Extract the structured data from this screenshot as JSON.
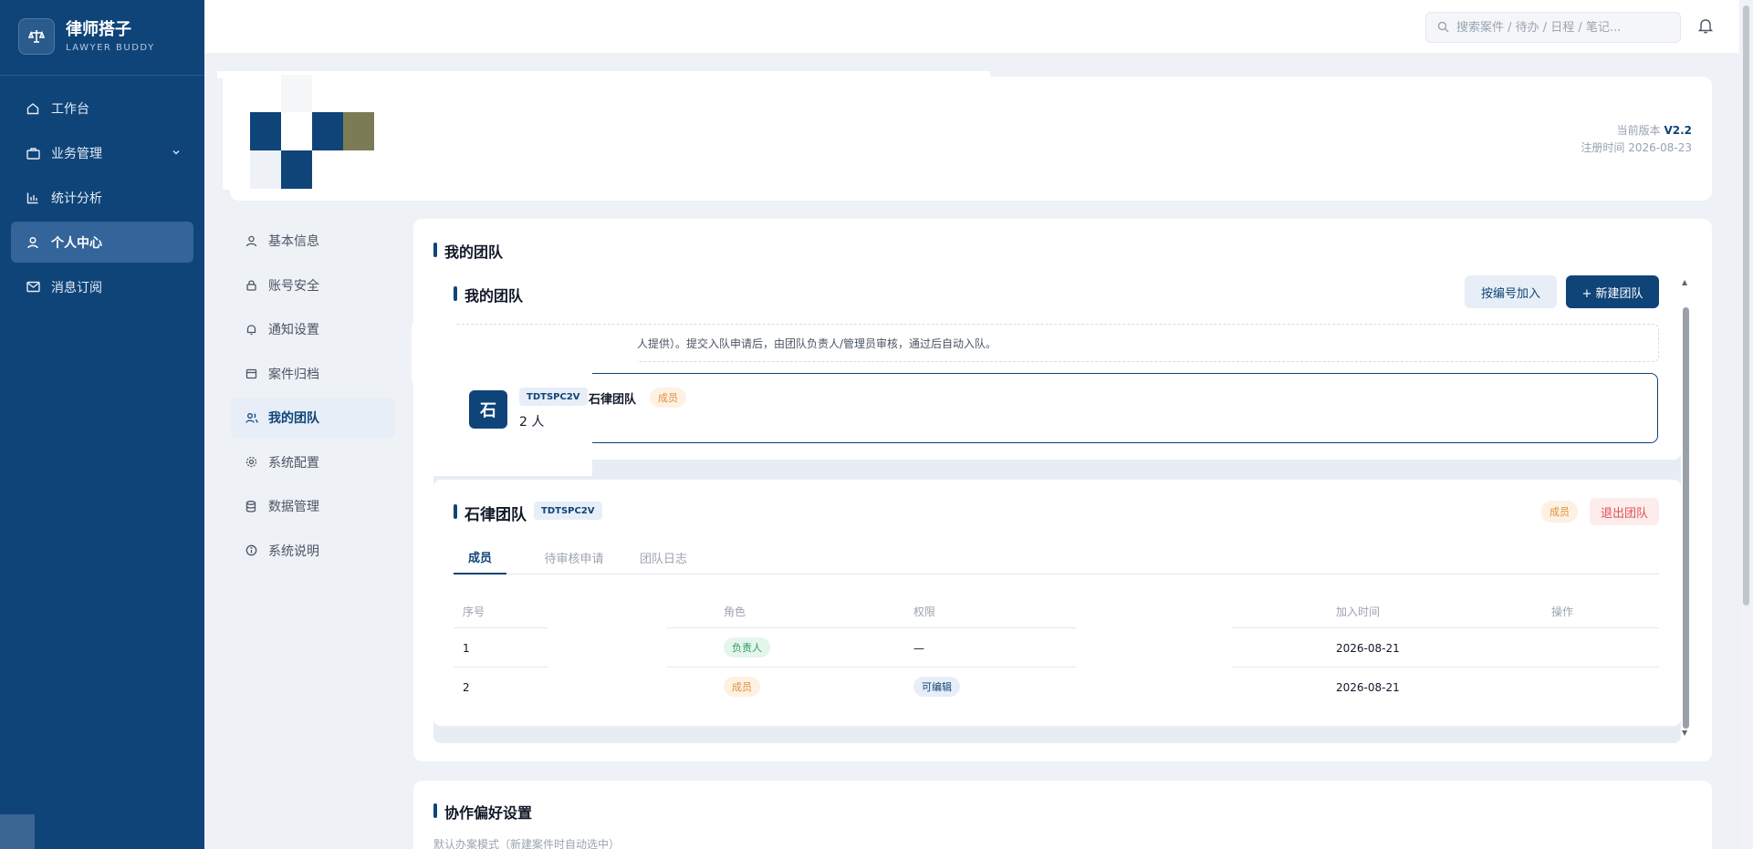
{
  "brand": {
    "name": "律师搭子",
    "subtitle": "LAWYER BUDDY",
    "logo_icon": "scale-icon"
  },
  "sidebar": {
    "items": [
      {
        "label": "工作台",
        "icon": "home-icon"
      },
      {
        "label": "业务管理",
        "icon": "briefcase-icon",
        "expandable": true
      },
      {
        "label": "统计分析",
        "icon": "bar-chart-icon"
      },
      {
        "label": "个人中心",
        "icon": "user-icon",
        "active": true
      },
      {
        "label": "消息订阅",
        "icon": "mail-icon"
      }
    ]
  },
  "header": {
    "search_placeholder": "搜索案件 / 待办 / 日程 / 笔记..."
  },
  "profile": {
    "version_label": "当前版本",
    "version": "V2.2",
    "register_label": "注册时间",
    "register_date": "2026-08-23",
    "mosaic_colors": [
      "#0f4479",
      "#7b7c55",
      "#eef1f6"
    ]
  },
  "submenu": {
    "items": [
      {
        "label": "基本信息",
        "icon": "user-icon"
      },
      {
        "label": "账号安全",
        "icon": "lock-icon"
      },
      {
        "label": "通知设置",
        "icon": "bell-icon"
      },
      {
        "label": "案件归档",
        "icon": "calendar-icon"
      },
      {
        "label": "我的团队",
        "icon": "users-icon",
        "active": true
      },
      {
        "label": "系统配置",
        "icon": "gear-icon"
      },
      {
        "label": "数据管理",
        "icon": "database-icon"
      },
      {
        "label": "系统说明",
        "icon": "info-icon"
      }
    ]
  },
  "team_section": {
    "title": "我的团队",
    "panel_title": "我的团队",
    "join_button": "按编号加入",
    "new_button": "+ 新建团队",
    "tip": "人提供）。提交入队申请后，由团队负责人/管理员审核，通过后自动入队。",
    "team": {
      "avatar": "石",
      "code": "TDTSPC2V",
      "name": "石律团队",
      "role": "成员",
      "count": "2 人"
    }
  },
  "team_detail": {
    "name": "石律团队",
    "code": "TDTSPC2V",
    "role": "成员",
    "quit_button": "退出团队",
    "tabs": [
      "成员",
      "待审核申请",
      "团队日志"
    ],
    "columns": [
      "序号",
      "角色",
      "权限",
      "加入时间",
      "操作"
    ],
    "rows": [
      {
        "index": "1",
        "role": "负责人",
        "permission": "—",
        "joined": "2026-08-21"
      },
      {
        "index": "2",
        "role": "成员",
        "permission": "可编辑",
        "joined": "2026-08-21"
      }
    ]
  },
  "collab": {
    "title": "协作偏好设置",
    "subtitle": "默认办案模式（新建案件时自动选中）"
  },
  "colors": {
    "primary": "#0f4479",
    "member": "#e0913b",
    "leader": "#2f9a5e",
    "danger": "#e05252"
  }
}
